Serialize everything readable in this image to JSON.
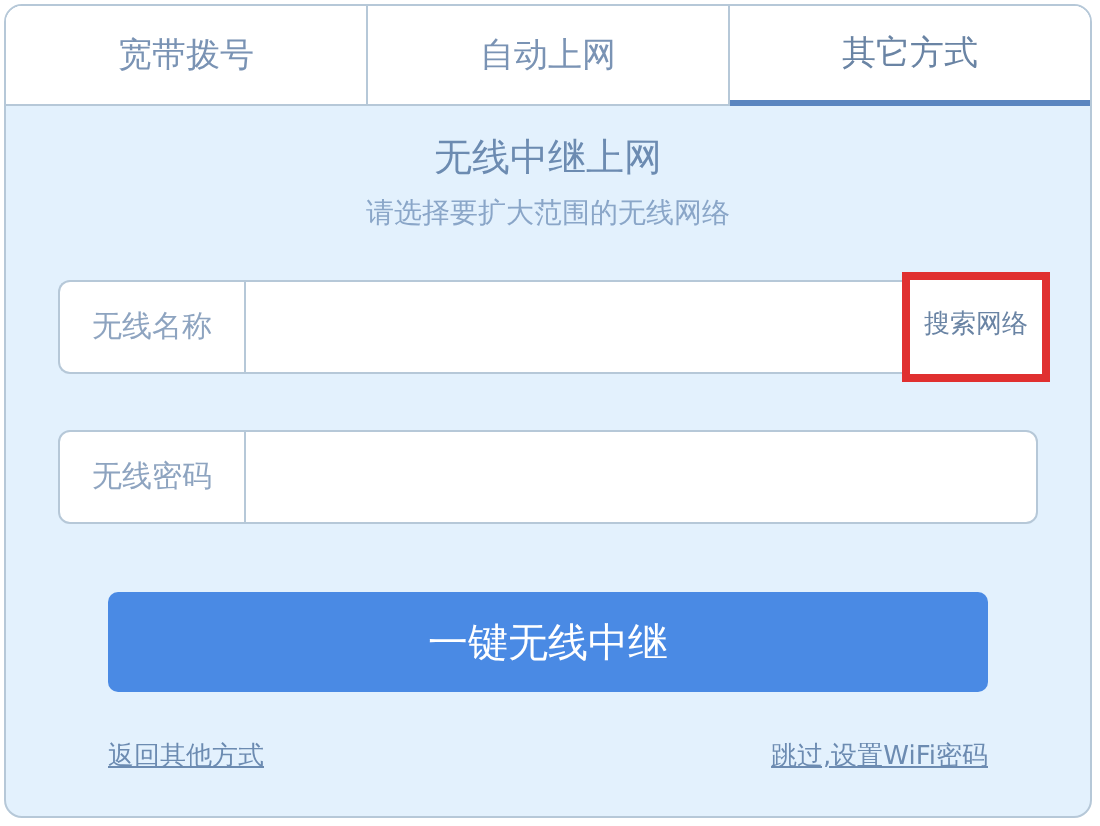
{
  "tabs": [
    {
      "label": "宽带拨号",
      "selected": false
    },
    {
      "label": "自动上网",
      "selected": false
    },
    {
      "label": "其它方式",
      "selected": true
    }
  ],
  "title": "无线中继上网",
  "subtitle": "请选择要扩大范围的无线网络",
  "fields": [
    {
      "label": "无线名称",
      "action": {
        "label": "搜索网络",
        "highlighted": true
      }
    },
    {
      "label": "无线密码"
    }
  ],
  "submit": "一键无线中继",
  "links": [
    {
      "label": "返回其他方式"
    },
    {
      "label": "跳过,设置WiFi密码"
    }
  ]
}
